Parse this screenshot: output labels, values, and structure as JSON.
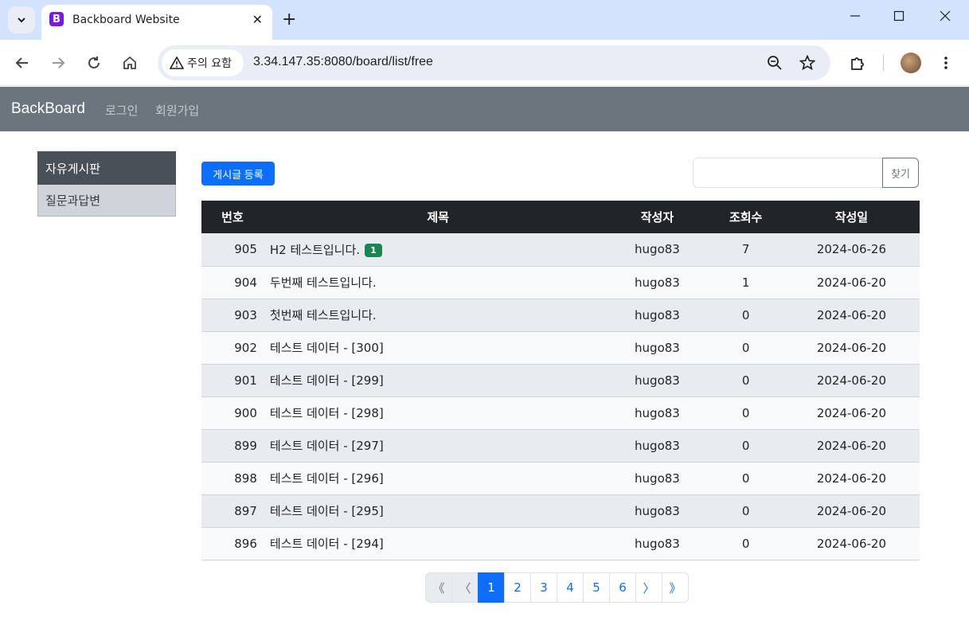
{
  "browser": {
    "tab_title": "Backboard Website",
    "favicon_letter": "B",
    "security_label": "주의 요함",
    "url": "3.34.147.35:8080/board/list/free"
  },
  "nav": {
    "brand": "BackBoard",
    "links": [
      "로그인",
      "회원가입"
    ]
  },
  "sidebar": {
    "items": [
      {
        "label": "자유게시판",
        "active": true
      },
      {
        "label": "질문과답변",
        "active": false
      }
    ]
  },
  "toolbar": {
    "write_label": "게시글 등록",
    "search_placeholder": "",
    "search_button": "찾기"
  },
  "table": {
    "headers": [
      "번호",
      "제목",
      "작성자",
      "조회수",
      "작성일"
    ],
    "rows": [
      {
        "no": "905",
        "title": "H2 테스트입니다.",
        "badge": "1",
        "writer": "hugo83",
        "views": "7",
        "date": "2024-06-26"
      },
      {
        "no": "904",
        "title": "두번째 테스트입니다.",
        "badge": "",
        "writer": "hugo83",
        "views": "1",
        "date": "2024-06-20"
      },
      {
        "no": "903",
        "title": "첫번째 테스트입니다.",
        "badge": "",
        "writer": "hugo83",
        "views": "0",
        "date": "2024-06-20"
      },
      {
        "no": "902",
        "title": "테스트 데이터 - [300]",
        "badge": "",
        "writer": "hugo83",
        "views": "0",
        "date": "2024-06-20"
      },
      {
        "no": "901",
        "title": "테스트 데이터 - [299]",
        "badge": "",
        "writer": "hugo83",
        "views": "0",
        "date": "2024-06-20"
      },
      {
        "no": "900",
        "title": "테스트 데이터 - [298]",
        "badge": "",
        "writer": "hugo83",
        "views": "0",
        "date": "2024-06-20"
      },
      {
        "no": "899",
        "title": "테스트 데이터 - [297]",
        "badge": "",
        "writer": "hugo83",
        "views": "0",
        "date": "2024-06-20"
      },
      {
        "no": "898",
        "title": "테스트 데이터 - [296]",
        "badge": "",
        "writer": "hugo83",
        "views": "0",
        "date": "2024-06-20"
      },
      {
        "no": "897",
        "title": "테스트 데이터 - [295]",
        "badge": "",
        "writer": "hugo83",
        "views": "0",
        "date": "2024-06-20"
      },
      {
        "no": "896",
        "title": "테스트 데이터 - [294]",
        "badge": "",
        "writer": "hugo83",
        "views": "0",
        "date": "2024-06-20"
      }
    ]
  },
  "pagination": {
    "first": "《",
    "prev": "〈",
    "pages": [
      "1",
      "2",
      "3",
      "4",
      "5",
      "6"
    ],
    "current": "1",
    "next": "〉",
    "last": "》"
  },
  "colors": {
    "primary": "#0d6efd",
    "navbar": "#6c757d",
    "table_head": "#212529",
    "badge": "#198754",
    "sidebar_active": "#495057",
    "sidebar_item": "#ced4da"
  }
}
